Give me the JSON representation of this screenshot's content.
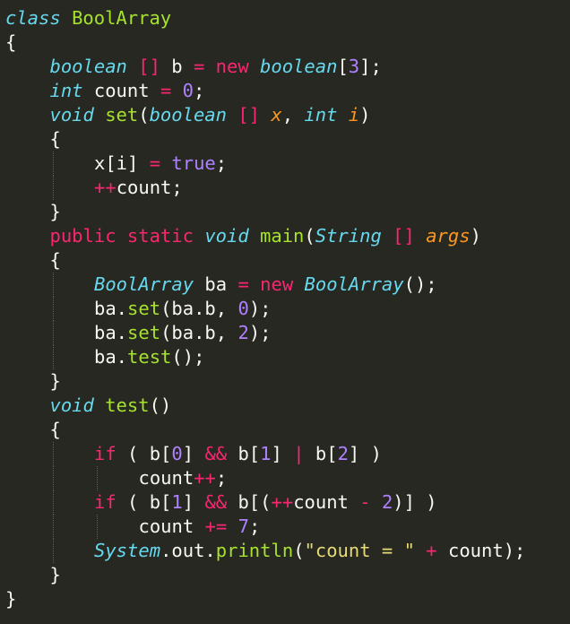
{
  "code": {
    "lines": [
      {
        "indent": 0,
        "tokens": [
          {
            "t": "class",
            "c": "type"
          },
          {
            "t": " ",
            "c": "pl"
          },
          {
            "t": "BoolArray",
            "c": "cls"
          }
        ]
      },
      {
        "indent": 0,
        "tokens": [
          {
            "t": "{",
            "c": "pl"
          }
        ]
      },
      {
        "indent": 1,
        "tokens": [
          {
            "t": "boolean",
            "c": "type"
          },
          {
            "t": " ",
            "c": "pl"
          },
          {
            "t": "[]",
            "c": "op"
          },
          {
            "t": " b ",
            "c": "pl"
          },
          {
            "t": "=",
            "c": "op"
          },
          {
            "t": " ",
            "c": "pl"
          },
          {
            "t": "new",
            "c": "kw"
          },
          {
            "t": " ",
            "c": "pl"
          },
          {
            "t": "boolean",
            "c": "type"
          },
          {
            "t": "[",
            "c": "pl"
          },
          {
            "t": "3",
            "c": "num"
          },
          {
            "t": "];",
            "c": "pl"
          }
        ]
      },
      {
        "indent": 1,
        "tokens": [
          {
            "t": "int",
            "c": "type"
          },
          {
            "t": " count ",
            "c": "pl"
          },
          {
            "t": "=",
            "c": "op"
          },
          {
            "t": " ",
            "c": "pl"
          },
          {
            "t": "0",
            "c": "num"
          },
          {
            "t": ";",
            "c": "pl"
          }
        ]
      },
      {
        "indent": 1,
        "tokens": [
          {
            "t": "void",
            "c": "type"
          },
          {
            "t": " ",
            "c": "pl"
          },
          {
            "t": "set",
            "c": "fn"
          },
          {
            "t": "(",
            "c": "pl"
          },
          {
            "t": "boolean",
            "c": "type"
          },
          {
            "t": " ",
            "c": "pl"
          },
          {
            "t": "[]",
            "c": "op"
          },
          {
            "t": " ",
            "c": "pl"
          },
          {
            "t": "x",
            "c": "par"
          },
          {
            "t": ", ",
            "c": "pl"
          },
          {
            "t": "int",
            "c": "type"
          },
          {
            "t": " ",
            "c": "pl"
          },
          {
            "t": "i",
            "c": "par"
          },
          {
            "t": ")",
            "c": "pl"
          }
        ]
      },
      {
        "indent": 1,
        "tokens": [
          {
            "t": "{",
            "c": "pl"
          }
        ]
      },
      {
        "indent": 2,
        "tokens": [
          {
            "t": "x[i] ",
            "c": "pl"
          },
          {
            "t": "=",
            "c": "op"
          },
          {
            "t": " ",
            "c": "pl"
          },
          {
            "t": "true",
            "c": "num"
          },
          {
            "t": ";",
            "c": "pl"
          }
        ]
      },
      {
        "indent": 2,
        "tokens": [
          {
            "t": "++",
            "c": "op"
          },
          {
            "t": "count;",
            "c": "pl"
          }
        ]
      },
      {
        "indent": 1,
        "tokens": [
          {
            "t": "}",
            "c": "pl"
          }
        ]
      },
      {
        "indent": 1,
        "tokens": [
          {
            "t": "public",
            "c": "kw"
          },
          {
            "t": " ",
            "c": "pl"
          },
          {
            "t": "static",
            "c": "kw"
          },
          {
            "t": " ",
            "c": "pl"
          },
          {
            "t": "void",
            "c": "type"
          },
          {
            "t": " ",
            "c": "pl"
          },
          {
            "t": "main",
            "c": "fn"
          },
          {
            "t": "(",
            "c": "pl"
          },
          {
            "t": "String",
            "c": "type"
          },
          {
            "t": " ",
            "c": "pl"
          },
          {
            "t": "[]",
            "c": "op"
          },
          {
            "t": " ",
            "c": "pl"
          },
          {
            "t": "args",
            "c": "par"
          },
          {
            "t": ")",
            "c": "pl"
          }
        ]
      },
      {
        "indent": 1,
        "tokens": [
          {
            "t": "{",
            "c": "pl"
          }
        ]
      },
      {
        "indent": 2,
        "tokens": [
          {
            "t": "BoolArray",
            "c": "type"
          },
          {
            "t": " ba ",
            "c": "pl"
          },
          {
            "t": "=",
            "c": "op"
          },
          {
            "t": " ",
            "c": "pl"
          },
          {
            "t": "new",
            "c": "kw"
          },
          {
            "t": " ",
            "c": "pl"
          },
          {
            "t": "BoolArray",
            "c": "type"
          },
          {
            "t": "();",
            "c": "pl"
          }
        ]
      },
      {
        "indent": 2,
        "tokens": [
          {
            "t": "ba.",
            "c": "pl"
          },
          {
            "t": "set",
            "c": "fn"
          },
          {
            "t": "(ba.b, ",
            "c": "pl"
          },
          {
            "t": "0",
            "c": "num"
          },
          {
            "t": ");",
            "c": "pl"
          }
        ]
      },
      {
        "indent": 2,
        "tokens": [
          {
            "t": "ba.",
            "c": "pl"
          },
          {
            "t": "set",
            "c": "fn"
          },
          {
            "t": "(ba.b, ",
            "c": "pl"
          },
          {
            "t": "2",
            "c": "num"
          },
          {
            "t": ");",
            "c": "pl"
          }
        ]
      },
      {
        "indent": 2,
        "tokens": [
          {
            "t": "ba.",
            "c": "pl"
          },
          {
            "t": "test",
            "c": "fn"
          },
          {
            "t": "();",
            "c": "pl"
          }
        ]
      },
      {
        "indent": 1,
        "tokens": [
          {
            "t": "}",
            "c": "pl"
          }
        ]
      },
      {
        "indent": 1,
        "tokens": [
          {
            "t": "void",
            "c": "type"
          },
          {
            "t": " ",
            "c": "pl"
          },
          {
            "t": "test",
            "c": "fn"
          },
          {
            "t": "()",
            "c": "pl"
          }
        ]
      },
      {
        "indent": 1,
        "tokens": [
          {
            "t": "{",
            "c": "pl"
          }
        ]
      },
      {
        "indent": 2,
        "tokens": [
          {
            "t": "if",
            "c": "kw"
          },
          {
            "t": " ( b[",
            "c": "pl"
          },
          {
            "t": "0",
            "c": "num"
          },
          {
            "t": "] ",
            "c": "pl"
          },
          {
            "t": "&&",
            "c": "op"
          },
          {
            "t": " b[",
            "c": "pl"
          },
          {
            "t": "1",
            "c": "num"
          },
          {
            "t": "] ",
            "c": "pl"
          },
          {
            "t": "|",
            "c": "op"
          },
          {
            "t": " b[",
            "c": "pl"
          },
          {
            "t": "2",
            "c": "num"
          },
          {
            "t": "] )",
            "c": "pl"
          }
        ]
      },
      {
        "indent": 3,
        "tokens": [
          {
            "t": "count",
            "c": "pl"
          },
          {
            "t": "++",
            "c": "op"
          },
          {
            "t": ";",
            "c": "pl"
          }
        ]
      },
      {
        "indent": 2,
        "tokens": [
          {
            "t": "if",
            "c": "kw"
          },
          {
            "t": " ( b[",
            "c": "pl"
          },
          {
            "t": "1",
            "c": "num"
          },
          {
            "t": "] ",
            "c": "pl"
          },
          {
            "t": "&&",
            "c": "op"
          },
          {
            "t": " b[(",
            "c": "pl"
          },
          {
            "t": "++",
            "c": "op"
          },
          {
            "t": "count ",
            "c": "pl"
          },
          {
            "t": "-",
            "c": "op"
          },
          {
            "t": " ",
            "c": "pl"
          },
          {
            "t": "2",
            "c": "num"
          },
          {
            "t": ")] )",
            "c": "pl"
          }
        ]
      },
      {
        "indent": 3,
        "tokens": [
          {
            "t": "count ",
            "c": "pl"
          },
          {
            "t": "+=",
            "c": "op"
          },
          {
            "t": " ",
            "c": "pl"
          },
          {
            "t": "7",
            "c": "num"
          },
          {
            "t": ";",
            "c": "pl"
          }
        ]
      },
      {
        "indent": 2,
        "tokens": [
          {
            "t": "System",
            "c": "type"
          },
          {
            "t": ".out.",
            "c": "pl"
          },
          {
            "t": "println",
            "c": "fn"
          },
          {
            "t": "(",
            "c": "pl"
          },
          {
            "t": "\"count = \"",
            "c": "str"
          },
          {
            "t": " ",
            "c": "pl"
          },
          {
            "t": "+",
            "c": "op"
          },
          {
            "t": " count);",
            "c": "pl"
          }
        ]
      },
      {
        "indent": 1,
        "tokens": [
          {
            "t": "}",
            "c": "pl"
          }
        ]
      },
      {
        "indent": 0,
        "tokens": [
          {
            "t": "}",
            "c": "pl"
          }
        ]
      }
    ]
  },
  "colors": {
    "background": "#272822",
    "plain": "#f8f8f2",
    "keyword": "#f92672",
    "type_italic": "#66d9ef",
    "function": "#a6e22e",
    "number": "#ae81ff",
    "string": "#e6db74",
    "parameter": "#fd971f"
  }
}
